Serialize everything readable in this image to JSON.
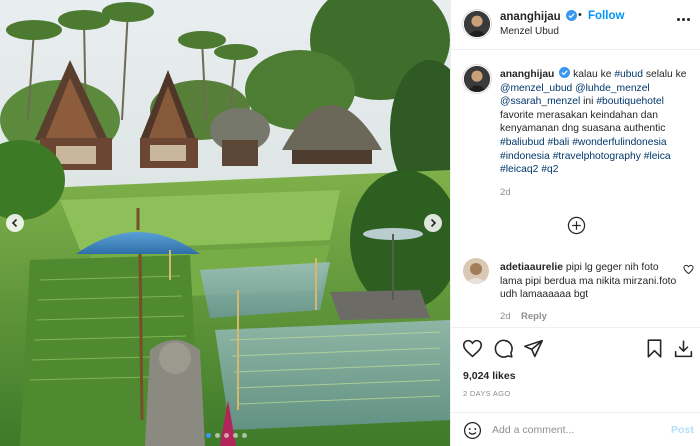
{
  "post": {
    "username": "ananghijau",
    "verified": true,
    "follow_label": "Follow",
    "separator": "•",
    "location": "Menzel Ubud"
  },
  "caption": {
    "username": "ananghijau",
    "parts": [
      {
        "text": "kalau ke ",
        "tag": false
      },
      {
        "text": "#ubud",
        "tag": true
      },
      {
        "text": " selalu ke ",
        "tag": false
      },
      {
        "text": "@menzel_ubud",
        "tag": true
      },
      {
        "text": " ",
        "tag": false
      },
      {
        "text": "@luhde_menzel",
        "tag": true
      },
      {
        "text": " ",
        "tag": false
      },
      {
        "text": "@ssarah_menzel",
        "tag": true
      },
      {
        "text": " ini ",
        "tag": false
      },
      {
        "text": "#boutiquehotel",
        "tag": true
      },
      {
        "text": " favorite merasakan keindahan dan kenyamanan dng suasana authentic ",
        "tag": false
      },
      {
        "text": "#baliubud",
        "tag": true
      },
      {
        "text": " ",
        "tag": false
      },
      {
        "text": "#bali",
        "tag": true
      },
      {
        "text": " ",
        "tag": false
      },
      {
        "text": "#wonderfulindonesia",
        "tag": true
      },
      {
        "text": " ",
        "tag": false
      },
      {
        "text": "#indonesia",
        "tag": true
      },
      {
        "text": " ",
        "tag": false
      },
      {
        "text": "#travelphotography",
        "tag": true
      },
      {
        "text": " ",
        "tag": false
      },
      {
        "text": "#leica",
        "tag": true
      },
      {
        "text": " ",
        "tag": false
      },
      {
        "text": "#leicaq2",
        "tag": true
      },
      {
        "text": " ",
        "tag": false
      },
      {
        "text": "#q2",
        "tag": true
      }
    ],
    "time": "2d"
  },
  "comment": {
    "username": "adetiaaurelie",
    "text": "pipi lg geger nih foto lama pipi berdua ma nikita mirzani.foto udh lamaaaaaa bgt",
    "time": "2d",
    "reply_label": "Reply"
  },
  "stats": {
    "likes": "9,024 likes",
    "date": "2 DAYS AGO"
  },
  "add_comment": {
    "placeholder": "Add a comment...",
    "post_label": "Post"
  },
  "carousel": {
    "count": 5,
    "active_index": 0
  },
  "icons": {
    "prev": "chevron-left-icon",
    "next": "chevron-right-icon",
    "more": "more-options-icon",
    "load_more": "plus-circle-icon",
    "like": "heart-icon",
    "comment": "comment-icon",
    "share": "paper-plane-icon",
    "save": "bookmark-icon",
    "download": "download-icon",
    "emoji": "emoji-icon"
  },
  "colors": {
    "link_blue": "#0095f6",
    "tag_blue": "#00376b",
    "muted": "#8e8e8e",
    "active_dot": "#3897f0"
  }
}
